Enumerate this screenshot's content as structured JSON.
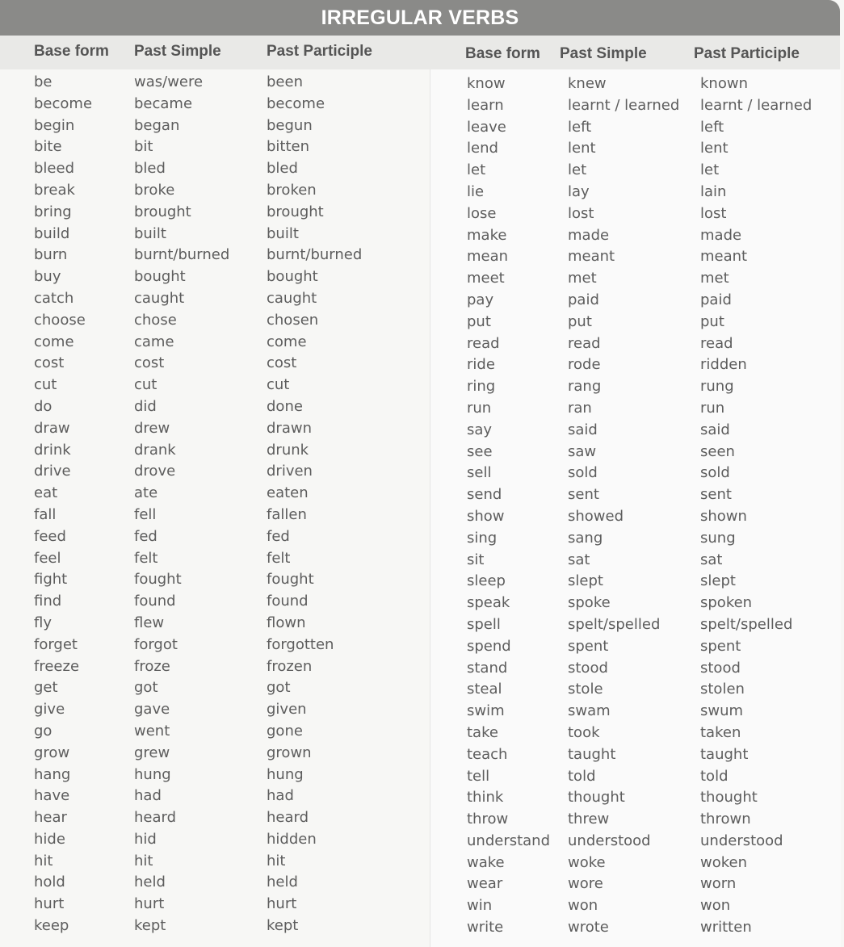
{
  "title": "IRREGULAR VERBS",
  "headers": {
    "base": "Base form",
    "past": "Past Simple",
    "participle": "Past Participle"
  },
  "left": {
    "base": [
      "be",
      "become",
      "begin",
      "bite",
      "bleed",
      "break",
      "bring",
      "build",
      "burn",
      "buy",
      "catch",
      "choose",
      "come",
      "cost",
      "cut",
      "do",
      "draw",
      "drink",
      "drive",
      "eat",
      "fall",
      "feed",
      "feel",
      "fight",
      "find",
      "fly",
      "forget",
      "freeze",
      "get",
      "give",
      "go",
      "grow",
      "hang",
      "have",
      "hear",
      "hide",
      "hit",
      "hold",
      "hurt",
      "keep"
    ],
    "past": [
      "was/were",
      "became",
      "began",
      "bit",
      "bled",
      "broke",
      "brought",
      "built",
      "burnt/burned",
      "bought",
      "caught",
      "chose",
      "came",
      "cost",
      "cut",
      "did",
      "drew",
      "drank",
      "drove",
      "ate",
      "fell",
      "fed",
      "felt",
      "fought",
      "found",
      "flew",
      "forgot",
      "froze",
      "got",
      "gave",
      "went",
      "grew",
      "hung",
      "had",
      "heard",
      "hid",
      "hit",
      "held",
      "hurt",
      "kept"
    ],
    "participle": [
      "been",
      "become",
      "begun",
      "bitten",
      "bled",
      "broken",
      "brought",
      "built",
      "burnt/burned",
      "bought",
      "caught",
      "chosen",
      "come",
      "cost",
      "cut",
      "done",
      "drawn",
      "drunk",
      "driven",
      "eaten",
      "fallen",
      "fed",
      "felt",
      "fought",
      "found",
      "flown",
      "forgotten",
      "frozen",
      "got",
      "given",
      "gone",
      "grown",
      "hung",
      "had",
      "heard",
      "hidden",
      "hit",
      "held",
      "hurt",
      "kept"
    ]
  },
  "right": {
    "base": [
      "know",
      "learn",
      "leave",
      "lend",
      "let",
      "lie",
      "lose",
      "make",
      "mean",
      "meet",
      "pay",
      "put",
      "read",
      "ride",
      "ring",
      "run",
      "say",
      "see",
      "sell",
      "send",
      "show",
      "sing",
      "sit",
      "sleep",
      "speak",
      "spell",
      "spend",
      "stand",
      "steal",
      "swim",
      "take",
      "teach",
      "tell",
      "think",
      "throw",
      "understand",
      "wake",
      "wear",
      "win",
      "write"
    ],
    "past": [
      "knew",
      "learnt / learned",
      "left",
      "lent",
      "let",
      "lay",
      "lost",
      "made",
      "meant",
      "met",
      "paid",
      "put",
      "read",
      "rode",
      "rang",
      "ran",
      "said",
      "saw",
      "sold",
      "sent",
      "showed",
      "sang",
      "sat",
      "slept",
      "spoke",
      "spelt/spelled",
      "spent",
      "stood",
      "stole",
      "swam",
      "took",
      "taught",
      "told",
      "thought",
      "threw",
      "understood",
      "woke",
      "wore",
      "won",
      "wrote"
    ],
    "participle": [
      "known",
      "learnt / learned",
      "left",
      "lent",
      "let",
      "lain",
      "lost",
      "made",
      "meant",
      "met",
      "paid",
      "put",
      "read",
      "ridden",
      "rung",
      "run",
      "said",
      "seen",
      "sold",
      "sent",
      "shown",
      "sung",
      "sat",
      "slept",
      "spoken",
      "spelt/spelled",
      "spent",
      "stood",
      "stolen",
      "swum",
      "taken",
      "taught",
      "told",
      "thought",
      "thrown",
      "understood",
      "woken",
      "worn",
      "won",
      "written"
    ]
  }
}
